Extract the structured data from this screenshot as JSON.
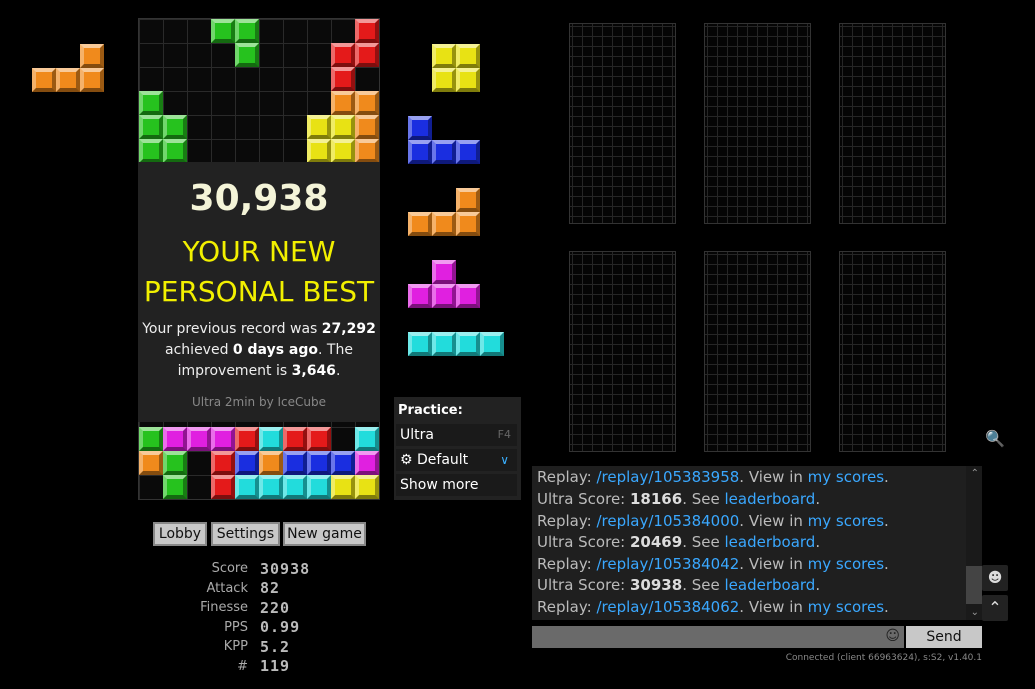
{
  "colors": {
    "orange": "#f08a1c",
    "yellow": "#e8e214",
    "blue": "#1a2ee0",
    "magenta": "#e020e0",
    "cyan": "#22dcdc",
    "green": "#26c21e",
    "red": "#e41a1a",
    "accent": "#3aa8ff",
    "pb": "#f2f000"
  },
  "hold_piece": "orange-L",
  "next_queue": [
    "yellow-O",
    "blue-J",
    "orange-L",
    "magenta-T",
    "cyan-I"
  ],
  "result": {
    "score": "30,938",
    "headline_1": "YOUR NEW",
    "headline_2": "PERSONAL BEST",
    "prev_text_1": "Your previous record was ",
    "prev_value": "27,292",
    "achieved_pre": "achieved ",
    "achieved_value": "0 days ago",
    "achieved_post": ". The",
    "improve_pre": "improvement is ",
    "improve_value": "3,646",
    "improve_post": ".",
    "mode": "Ultra 2min by IceCube"
  },
  "buttons": {
    "lobby": "Lobby",
    "settings": "Settings",
    "new_game": "New game"
  },
  "stats": [
    {
      "label": "Score",
      "value": "30938"
    },
    {
      "label": "Attack",
      "value": "82"
    },
    {
      "label": "Finesse",
      "value": "220"
    },
    {
      "label": "PPS",
      "value": "0.99"
    },
    {
      "label": "KPP",
      "value": "5.2"
    },
    {
      "label": "#",
      "value": "119"
    }
  ],
  "practice": {
    "title": "Practice:",
    "mode": "Ultra",
    "mode_key": "F4",
    "preset": "Default",
    "more": "Show more"
  },
  "chat": {
    "lines": [
      {
        "pre": "Replay: ",
        "link": "/replay/105383958",
        "mid": ". View in ",
        "link2": "my scores",
        "post": "."
      },
      {
        "pre": "Ultra Score: ",
        "bold": "18166",
        "mid": ". See ",
        "link2": "leaderboard",
        "post": "."
      },
      {
        "pre": "Replay: ",
        "link": "/replay/105384000",
        "mid": ". View in ",
        "link2": "my scores",
        "post": "."
      },
      {
        "pre": "Ultra Score: ",
        "bold": "20469",
        "mid": ". See ",
        "link2": "leaderboard",
        "post": "."
      },
      {
        "pre": "Replay: ",
        "link": "/replay/105384042",
        "mid": ". View in ",
        "link2": "my scores",
        "post": "."
      },
      {
        "pre": "Ultra Score: ",
        "bold": "30938",
        "mid": ". See ",
        "link2": "leaderboard",
        "post": "."
      },
      {
        "pre": "Replay: ",
        "link": "/replay/105384062",
        "mid": ". View in ",
        "link2": "my scores",
        "post": "."
      }
    ],
    "send": "Send",
    "status": "Connected (client 66963624), s:S2, v1.40.1"
  }
}
